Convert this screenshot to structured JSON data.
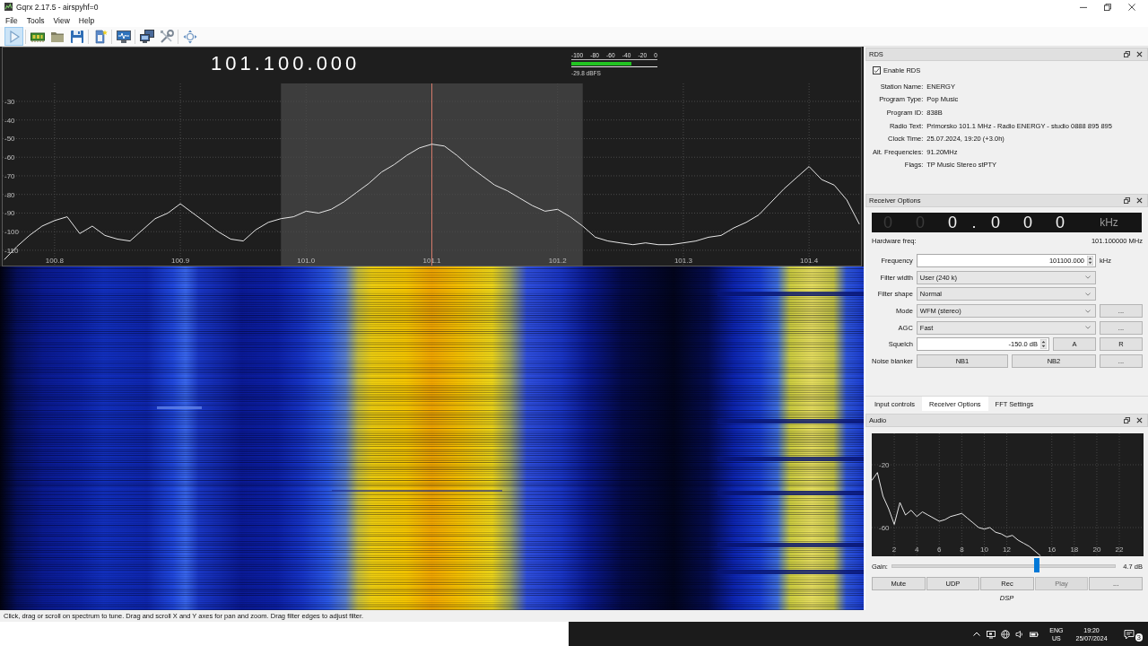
{
  "window": {
    "title": "Gqrx 2.17.5 - airspyhf=0"
  },
  "menu": [
    "File",
    "Tools",
    "View",
    "Help"
  ],
  "toolbar": [
    {
      "buttons": [
        {
          "kind": "play",
          "pressed": true
        }
      ]
    },
    {
      "buttons": [
        {
          "kind": "device",
          "pressed": false
        },
        {
          "kind": "open",
          "pressed": false
        },
        {
          "kind": "save",
          "pressed": false
        }
      ]
    },
    {
      "buttons": [
        {
          "kind": "document",
          "pressed": false
        }
      ]
    },
    {
      "buttons": [
        {
          "kind": "display",
          "pressed": false
        }
      ]
    },
    {
      "buttons": [
        {
          "kind": "network",
          "pressed": false
        },
        {
          "kind": "tools",
          "pressed": false
        }
      ]
    },
    {
      "buttons": [
        {
          "kind": "move",
          "pressed": false
        }
      ]
    }
  ],
  "spectrum": {
    "frequency_readout": "101.100.000",
    "meter": {
      "scale": [
        "-100",
        "-80",
        "-60",
        "-40",
        "-20",
        "0"
      ],
      "level": 0.7,
      "reading": "-29.8 dBFS"
    },
    "chart_data": [
      {
        "type": "line",
        "x": [
          100.76,
          100.77,
          100.78,
          100.79,
          100.8,
          100.81,
          100.82,
          100.83,
          100.84,
          100.85,
          100.86,
          100.87,
          100.88,
          100.89,
          100.9,
          100.91,
          100.92,
          100.93,
          100.94,
          100.95,
          100.96,
          100.97,
          100.98,
          100.99,
          101.0,
          101.01,
          101.02,
          101.03,
          101.04,
          101.05,
          101.06,
          101.07,
          101.08,
          101.09,
          101.1,
          101.11,
          101.12,
          101.13,
          101.14,
          101.15,
          101.16,
          101.17,
          101.18,
          101.19,
          101.2,
          101.21,
          101.22,
          101.23,
          101.24,
          101.25,
          101.26,
          101.27,
          101.28,
          101.29,
          101.3,
          101.31,
          101.32,
          101.33,
          101.34,
          101.35,
          101.36,
          101.37,
          101.38,
          101.39,
          101.4,
          101.41,
          101.42,
          101.43,
          101.44
        ],
        "values": [
          -115,
          -108,
          -102,
          -97,
          -94,
          -92,
          -101,
          -97,
          -102,
          -104,
          -105,
          -99,
          -93,
          -90,
          -85,
          -90,
          -95,
          -100,
          -104,
          -105,
          -99,
          -95,
          -93,
          -92,
          -89,
          -90,
          -88,
          -84,
          -79,
          -74,
          -68,
          -64,
          -59,
          -55,
          -53,
          -54,
          -59,
          -65,
          -70,
          -75,
          -78,
          -82,
          -86,
          -89,
          -88,
          -92,
          -97,
          -103,
          -105,
          -106,
          -107,
          -106,
          -107,
          -107,
          -106,
          -105,
          -103,
          -102,
          -98,
          -95,
          -91,
          -84,
          -77,
          -71,
          -65,
          -72,
          -75,
          -83,
          -96
        ],
        "color": "#e6e6e6",
        "xlim": [
          100.758,
          101.442
        ],
        "ylim": [
          -118.7,
          -0.6
        ],
        "xticks": [
          100.8,
          100.9,
          {
            "value": 101,
            "label": "101.0"
          },
          101.1,
          101.2,
          101.3,
          101.4
        ],
        "yticks": [
          -30,
          -40,
          -50,
          -60,
          -70,
          -80,
          -90,
          -100,
          -110
        ],
        "grid": true,
        "bands": [
          {
            "axis": "x",
            "from": 100.98,
            "to": 101.22,
            "color": "#3d3d3d"
          }
        ],
        "ref_lines": [
          {
            "axis": "x",
            "value": 101.1,
            "color": "#d47a6a"
          }
        ]
      }
    ]
  },
  "status_bar": "Click, drag or scroll on spectrum to tune. Drag and scroll X and Y axes for pan and zoom. Drag filter edges to adjust filter.",
  "rds": {
    "title": "RDS",
    "enable": {
      "label": "Enable RDS",
      "checked": true
    },
    "fields": [
      {
        "label": "Station Name:",
        "value": "ENERGY"
      },
      {
        "label": "Program Type:",
        "value": "Pop Music"
      },
      {
        "label": "Program ID:",
        "value": "838B"
      },
      {
        "label": "Radio Text:",
        "value": "Primorsko 101.1 MHz - Radio ENERGY - studio 0888 895 895"
      },
      {
        "label": "Clock Time:",
        "value": "25.07.2024, 19:20 (+3.0h)"
      },
      {
        "label": "Alt. Frequencies:",
        "value": "91.20MHz"
      },
      {
        "label": "Flags:",
        "value": "TP Music Stereo stPTY"
      }
    ]
  },
  "receiver_options": {
    "title": "Receiver Options",
    "offset_readout": {
      "digits": [
        {
          "kind": "digit",
          "text": "0",
          "lit": false
        },
        {
          "kind": "digit",
          "text": "0",
          "lit": false
        },
        {
          "kind": "digit",
          "text": "0",
          "lit": true
        },
        {
          "kind": "separator",
          "text": ".",
          "lit": true
        },
        {
          "kind": "digit",
          "text": "0",
          "lit": true
        },
        {
          "kind": "digit",
          "text": "0",
          "lit": true
        },
        {
          "kind": "digit",
          "text": "0",
          "lit": true
        }
      ],
      "unit": "kHz"
    },
    "hardware_freq": {
      "label": "Hardware freq:",
      "value": "101.100000 MHz"
    },
    "rows": [
      {
        "label": "Frequency",
        "controls": [
          {
            "kind": "spinbox",
            "value": "101100.000"
          },
          {
            "kind": "unit",
            "text": "kHz"
          }
        ]
      },
      {
        "label": "Filter width",
        "controls": [
          {
            "kind": "combo",
            "value": "User (240 k)"
          }
        ]
      },
      {
        "label": "Filter shape",
        "controls": [
          {
            "kind": "combo",
            "value": "Normal"
          }
        ]
      },
      {
        "label": "Mode",
        "controls": [
          {
            "kind": "combo",
            "value": "WFM (stereo)"
          },
          {
            "kind": "button",
            "text": "..."
          }
        ]
      },
      {
        "label": "AGC",
        "controls": [
          {
            "kind": "combo",
            "value": "Fast"
          },
          {
            "kind": "button",
            "text": "..."
          }
        ]
      },
      {
        "label": "Squelch",
        "controls": [
          {
            "kind": "spinbox",
            "value": "-150.0 dB"
          },
          {
            "kind": "button",
            "text": "A"
          },
          {
            "kind": "button",
            "text": "R"
          }
        ]
      },
      {
        "label": "Noise blanker",
        "controls": [
          {
            "kind": "button",
            "text": "NB1"
          },
          {
            "kind": "button",
            "text": "NB2"
          },
          {
            "kind": "button",
            "text": "..."
          }
        ]
      }
    ]
  },
  "tabs": [
    {
      "label": "Input controls",
      "selected": false
    },
    {
      "label": "Receiver Options",
      "selected": true
    },
    {
      "label": "FFT Settings",
      "selected": false
    }
  ],
  "audio": {
    "title": "Audio",
    "chart_data": [
      {
        "type": "line",
        "x": [
          0,
          0.5,
          1,
          1.5,
          2,
          2.5,
          3,
          3.5,
          4,
          4.5,
          5,
          5.5,
          6,
          6.5,
          7,
          7.5,
          8,
          8.5,
          9,
          9.5,
          10,
          10.5,
          11,
          11.5,
          12,
          12.5,
          13,
          13.5,
          14,
          14.5,
          15
        ],
        "values": [
          -30,
          -25,
          -40,
          -48,
          -58,
          -44,
          -52,
          -49,
          -53,
          -50,
          -52,
          -54,
          -56,
          -55,
          -53,
          -52,
          -51,
          -54,
          -57,
          -60,
          -61,
          -60,
          -63,
          -64,
          -66,
          -65,
          -68,
          -70,
          -72,
          -75,
          -78
        ],
        "color": "#e6e6e6",
        "xlim": [
          0,
          24.15
        ],
        "ylim": [
          -78.3,
          0
        ],
        "xticks": [
          2,
          4,
          6,
          8,
          10,
          12,
          16,
          18,
          20,
          22
        ],
        "yticks": [
          -20,
          -60
        ],
        "grid": true
      }
    ],
    "gain": {
      "label": "Gain:",
      "level": 0.65,
      "reading": "4.7 dB"
    },
    "buttons": [
      {
        "label": "Mute",
        "disabled": false
      },
      {
        "label": "UDP",
        "disabled": false
      },
      {
        "label": "Rec",
        "disabled": false
      },
      {
        "label": "Play",
        "disabled": true
      },
      {
        "label": "...",
        "disabled": false
      }
    ],
    "footer": "DSP"
  },
  "taskbar": {
    "language": "ENG",
    "region": "US",
    "time": "19:20",
    "date": "25/07/2024",
    "notifications": "3"
  }
}
